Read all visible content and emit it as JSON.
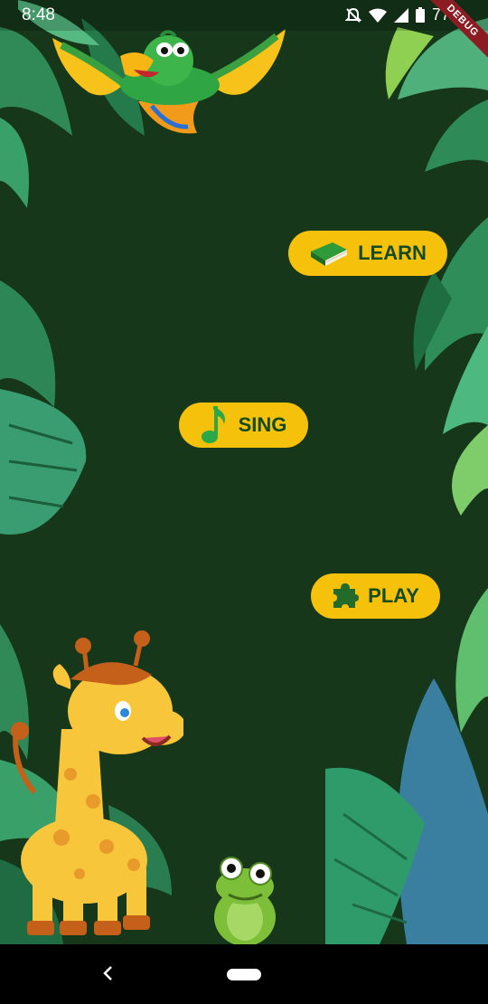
{
  "status_bar": {
    "time": "8:48",
    "battery": "77%",
    "debug_banner": "DEBUG",
    "icons": [
      "notifications-off-icon",
      "wifi-icon",
      "signal-icon",
      "battery-icon"
    ]
  },
  "menu": {
    "learn": {
      "label": "LEARN",
      "icon": "book-icon"
    },
    "sing": {
      "label": "SING",
      "icon": "music-note-icon"
    },
    "play": {
      "label": "PLAY",
      "icon": "puzzle-icon"
    }
  },
  "illustrations": [
    "parrot",
    "giraffe",
    "frog",
    "jungle-leaves"
  ],
  "nav_bar": {
    "buttons": [
      "back",
      "home"
    ]
  },
  "colors": {
    "background": "#17371b",
    "button": "#f6c10a",
    "button_text": "#134a1f",
    "leaf": "#2e8b57"
  }
}
